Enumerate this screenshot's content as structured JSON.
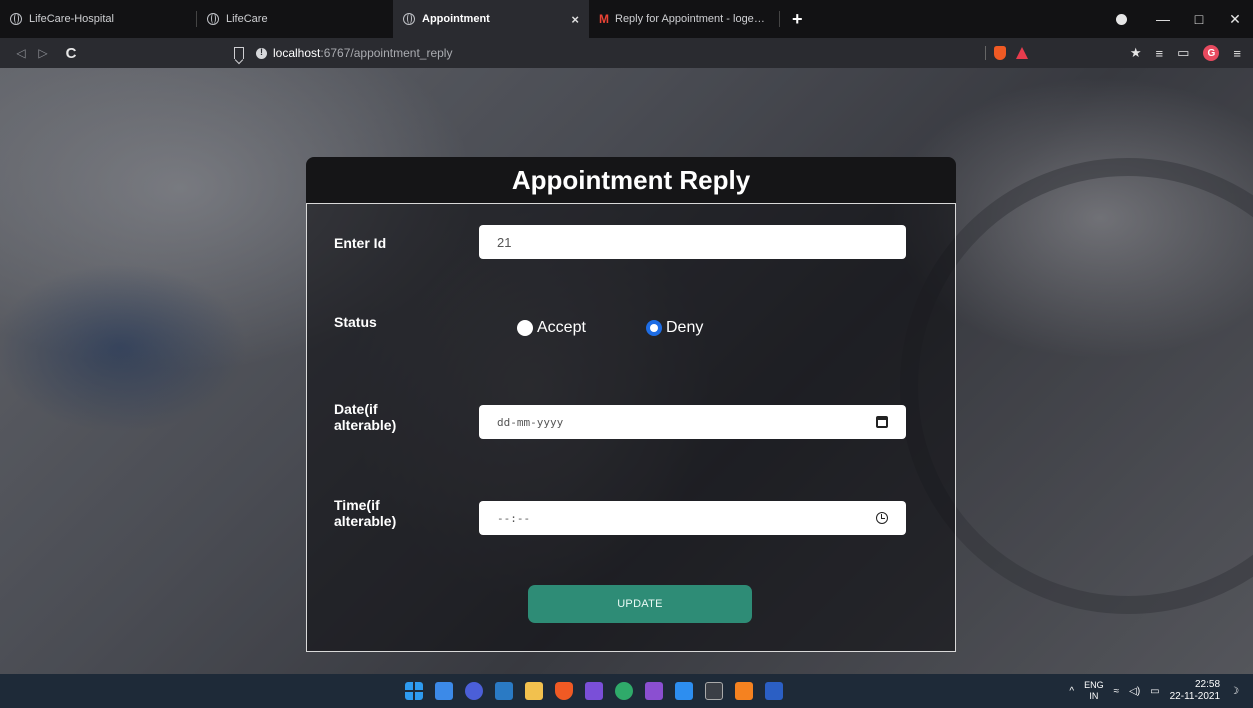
{
  "browser": {
    "tabs": [
      {
        "title": "LifeCare-Hospital",
        "active": false,
        "icon": "globe-icon"
      },
      {
        "title": "LifeCare",
        "active": false,
        "icon": "globe-icon"
      },
      {
        "title": "Appointment",
        "active": true,
        "icon": "globe-icon"
      },
      {
        "title": "Reply for Appointment - logeshavana",
        "active": false,
        "icon": "gmail-icon"
      }
    ],
    "close_tab": "×",
    "new_tab": "+",
    "window_controls": {
      "minimize": "—",
      "maximize": "□",
      "close": "✕"
    },
    "url": {
      "host": "localhost",
      "path": ":6767/appointment_reply"
    },
    "nav": {
      "back": "◁",
      "forward": "▷",
      "reload": "C"
    },
    "right_tools": {
      "extensions": "★",
      "playlist": "≡",
      "wallet": "▭",
      "menu": "≡",
      "ext_badge": "G"
    }
  },
  "form": {
    "title": "Appointment Reply",
    "id_label": "Enter Id",
    "id_value": "21",
    "status_label": "Status",
    "status_options": [
      {
        "label": "Accept",
        "checked": false
      },
      {
        "label": "Deny",
        "checked": true
      }
    ],
    "date_label_line1": "Date(if",
    "date_label_line2": "alterable)",
    "date_placeholder": "dd-mm-yyyy",
    "time_label_line1": "Time(if",
    "time_label_line2": "alterable)",
    "time_placeholder": "--:--",
    "submit_label": "UPDATE"
  },
  "taskbar": {
    "language": "ENG",
    "region": "IN",
    "time": "22:58",
    "date": "22-11-2021",
    "tray_caret": "^"
  },
  "colors": {
    "accent_button": "#2e8c76",
    "radio_checked": "#1e6de4",
    "taskbar": "#1e2a38"
  }
}
